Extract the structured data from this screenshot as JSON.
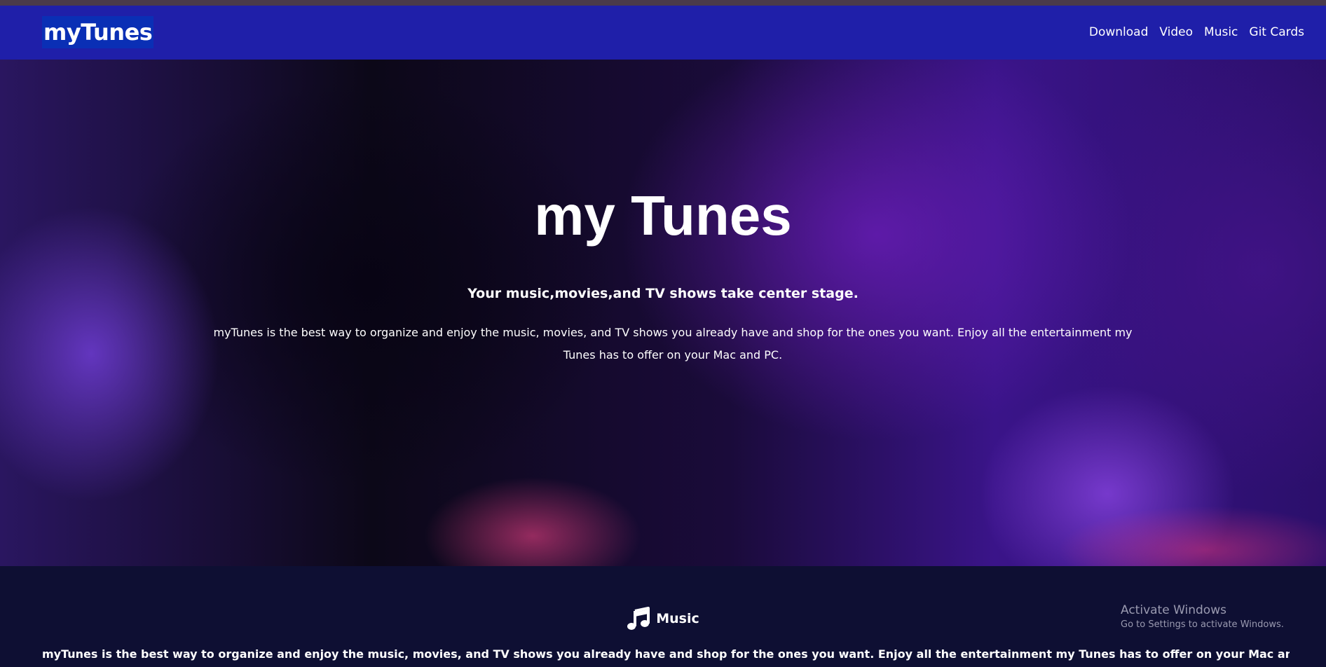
{
  "navbar": {
    "brand": "myTunes",
    "links": [
      "Download",
      "Video",
      "Music",
      "Git Cards"
    ]
  },
  "hero": {
    "title": "my Tunes",
    "subtitle": "Your music,movies,and TV shows take center stage.",
    "description": "myTunes is the best way to organize and enjoy the music, movies, and TV shows you already have and shop for the ones you want. Enjoy all the entertainment my Tunes has to offer on your Mac and PC."
  },
  "music_section": {
    "icon": "music-note-icon",
    "title": "Music",
    "text": "myTunes is the best way to organize and enjoy the music, movies, and TV shows you already have and shop for the ones you want. Enjoy all the entertainment my Tunes has to offer on your Mac and PC. myTunes is the"
  },
  "watermark": {
    "title": "Activate Windows",
    "subtitle": "Go to Settings to activate Windows."
  },
  "colors": {
    "navbar": "#1f1fa9",
    "brand_bg": "#0a2fb5",
    "section_bg": "#0e0f33",
    "text": "#ffffff"
  }
}
